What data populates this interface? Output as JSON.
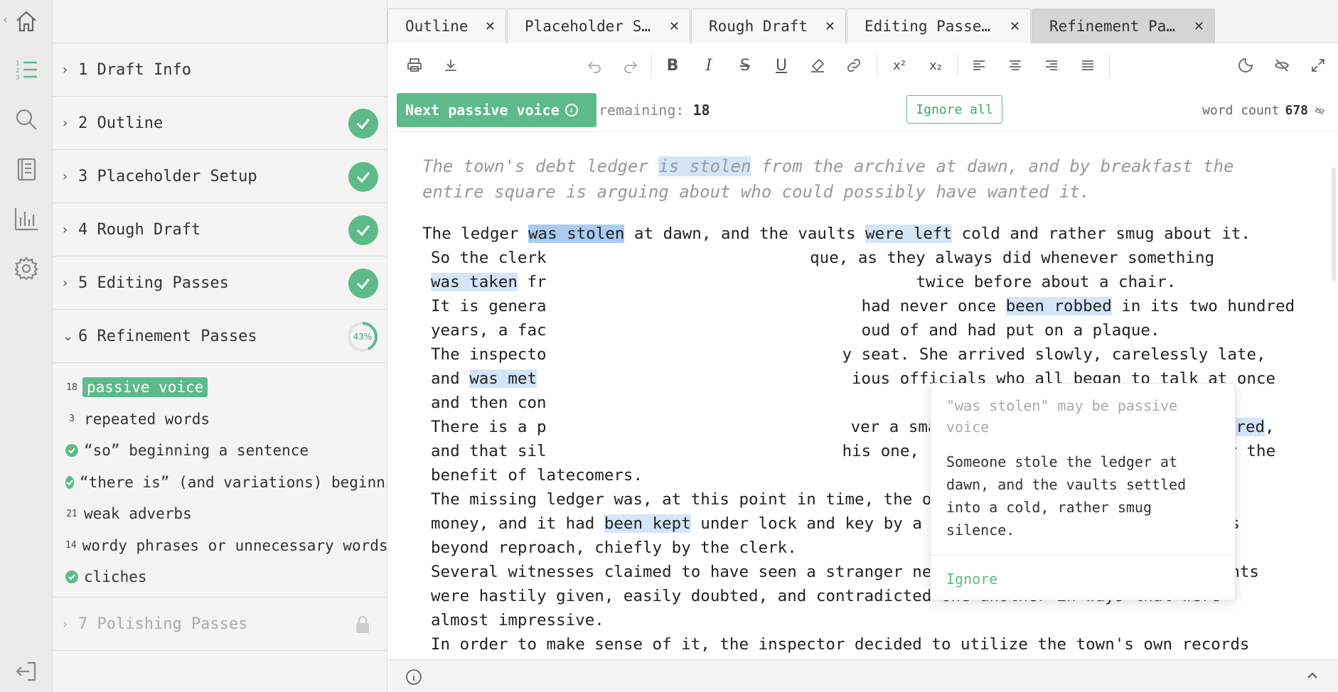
{
  "rail": {
    "icons": [
      "home-icon",
      "outline-list-icon",
      "search-icon",
      "notebook-icon",
      "stats-icon",
      "settings-icon",
      "logout-icon"
    ]
  },
  "sidebar": {
    "sections": [
      {
        "num": "1",
        "title": "Draft Info",
        "status": "none"
      },
      {
        "num": "2",
        "title": "Outline",
        "status": "done"
      },
      {
        "num": "3",
        "title": "Placeholder Setup",
        "status": "done"
      },
      {
        "num": "4",
        "title": "Rough Draft",
        "status": "done"
      },
      {
        "num": "5",
        "title": "Editing Passes",
        "status": "done"
      },
      {
        "num": "6",
        "title": "Refinement Passes",
        "status": "progress",
        "progress_label": "43%",
        "progress": 0.43
      },
      {
        "num": "7",
        "title": "Polishing Passes",
        "status": "locked"
      }
    ],
    "section_labels": {
      "s1": "1 Draft Info",
      "s2": "2 Outline",
      "s3": "3 Placeholder Setup",
      "s4": "4 Rough Draft",
      "s5": "5 Editing Passes",
      "s6": "6 Refinement Passes",
      "s7": "7 Polishing Passes"
    },
    "refinement_items": [
      {
        "count": "18",
        "label": "passive voice",
        "active": true
      },
      {
        "count": "3",
        "label": "repeated words"
      },
      {
        "count": "",
        "label": "“so” beginning a sentence",
        "done": true
      },
      {
        "count": "",
        "label": "“there is” (and variations) beginning a sentence",
        "done": true
      },
      {
        "count": "21",
        "label": "weak adverbs"
      },
      {
        "count": "14",
        "label": "wordy phrases or unnecessary words"
      },
      {
        "count": "",
        "label": "cliches",
        "done": true
      }
    ]
  },
  "tabs": [
    {
      "label": "Outline"
    },
    {
      "label": "Placeholder S…"
    },
    {
      "label": "Rough Draft"
    },
    {
      "label": "Editing Passe…"
    },
    {
      "label": "Refinement Pa…",
      "active": true
    }
  ],
  "toolbar": {
    "icons": [
      "print-icon",
      "download-icon",
      "undo-icon",
      "redo-icon",
      "bold-icon",
      "italic-icon",
      "strikethrough-icon",
      "underline-icon",
      "clear-format-icon",
      "link-icon",
      "superscript-icon",
      "subscript-icon",
      "align-left-icon",
      "align-center-icon",
      "align-right-icon",
      "justify-icon",
      "dark-mode-icon",
      "hide-icon",
      "fullscreen-icon"
    ],
    "superscript": "x²",
    "subscript": "x₂"
  },
  "passbar": {
    "next_label": "Next passive voice",
    "remaining_label": "remaining:",
    "remaining_value": "18",
    "ignore_all_label": "Ignore all",
    "word_count_label": "word count",
    "word_count_value": "678"
  },
  "editor": {
    "summary_parts": [
      "The town's debt ledger ",
      "is stolen",
      " from the archive at dawn, and by breakfast the entire square is arguing about who could possibly have wanted it."
    ],
    "line1": {
      "a": " The ledger ",
      "h1": "was stolen",
      "b": " at dawn, and the vaults ",
      "h2": "were left",
      "c": " cold and rather smug about it."
    },
    "line2": "So the clerk ",
    "line2b": "que, as they always did whenever something",
    "line3": {
      "h": "was taken",
      "a": " fr",
      "b": "twice before about a chair."
    },
    "line4": {
      "a": "It is genera",
      "b": "had never once ",
      "h": "been robbed",
      "c": " in its two hundred"
    },
    "line5": {
      "a": "years, a fac",
      "b": "oud of and had put on a plaque."
    },
    "line6": {
      "a": "The inspecto",
      "b": "y seat. She arrived slowly, carelessly late,"
    },
    "line7": {
      "a": "and ",
      "h": "was met",
      "b": "ious officials who all began to talk at once"
    },
    "line8": {
      "a": "and then con"
    },
    "line9": {
      "a": "There is a p",
      "b": "ver a small town when a crime ",
      "h": "is discovered",
      "c": ","
    },
    "line10": {
      "a": "and that sil",
      "b": "his one, then got up and fallen again for the"
    },
    "line11": "benefit of latecomers.",
    "line12": "The missing ledger was, at this point in time, the only record of who owed the town",
    "line13": {
      "a": "money, and it had ",
      "h": "been kept",
      "b": " under lock and key by a clerk who was widely regarded as"
    },
    "line14": "beyond reproach, chiefly by the clerk.",
    "line15": "Several witnesses claimed to have seen a stranger near the archive, but their accounts",
    "line16": "were hastily given, easily doubted, and contradicted one another in ways that were",
    "line17": "almost impressive.",
    "line18": "In order to make sense of it, the inspector decided to utilize the town's own records"
  },
  "popover": {
    "heading": "\"was stolen\" may be passive voice",
    "suggestion": "Someone stole the ledger at dawn, and the vaults settled into a cold, rather smug silence.",
    "ignore_label": "Ignore"
  },
  "colors": {
    "accent": "#5dbb8a",
    "highlight": "#d4e5f8",
    "highlight_current": "#a9cbf0"
  }
}
